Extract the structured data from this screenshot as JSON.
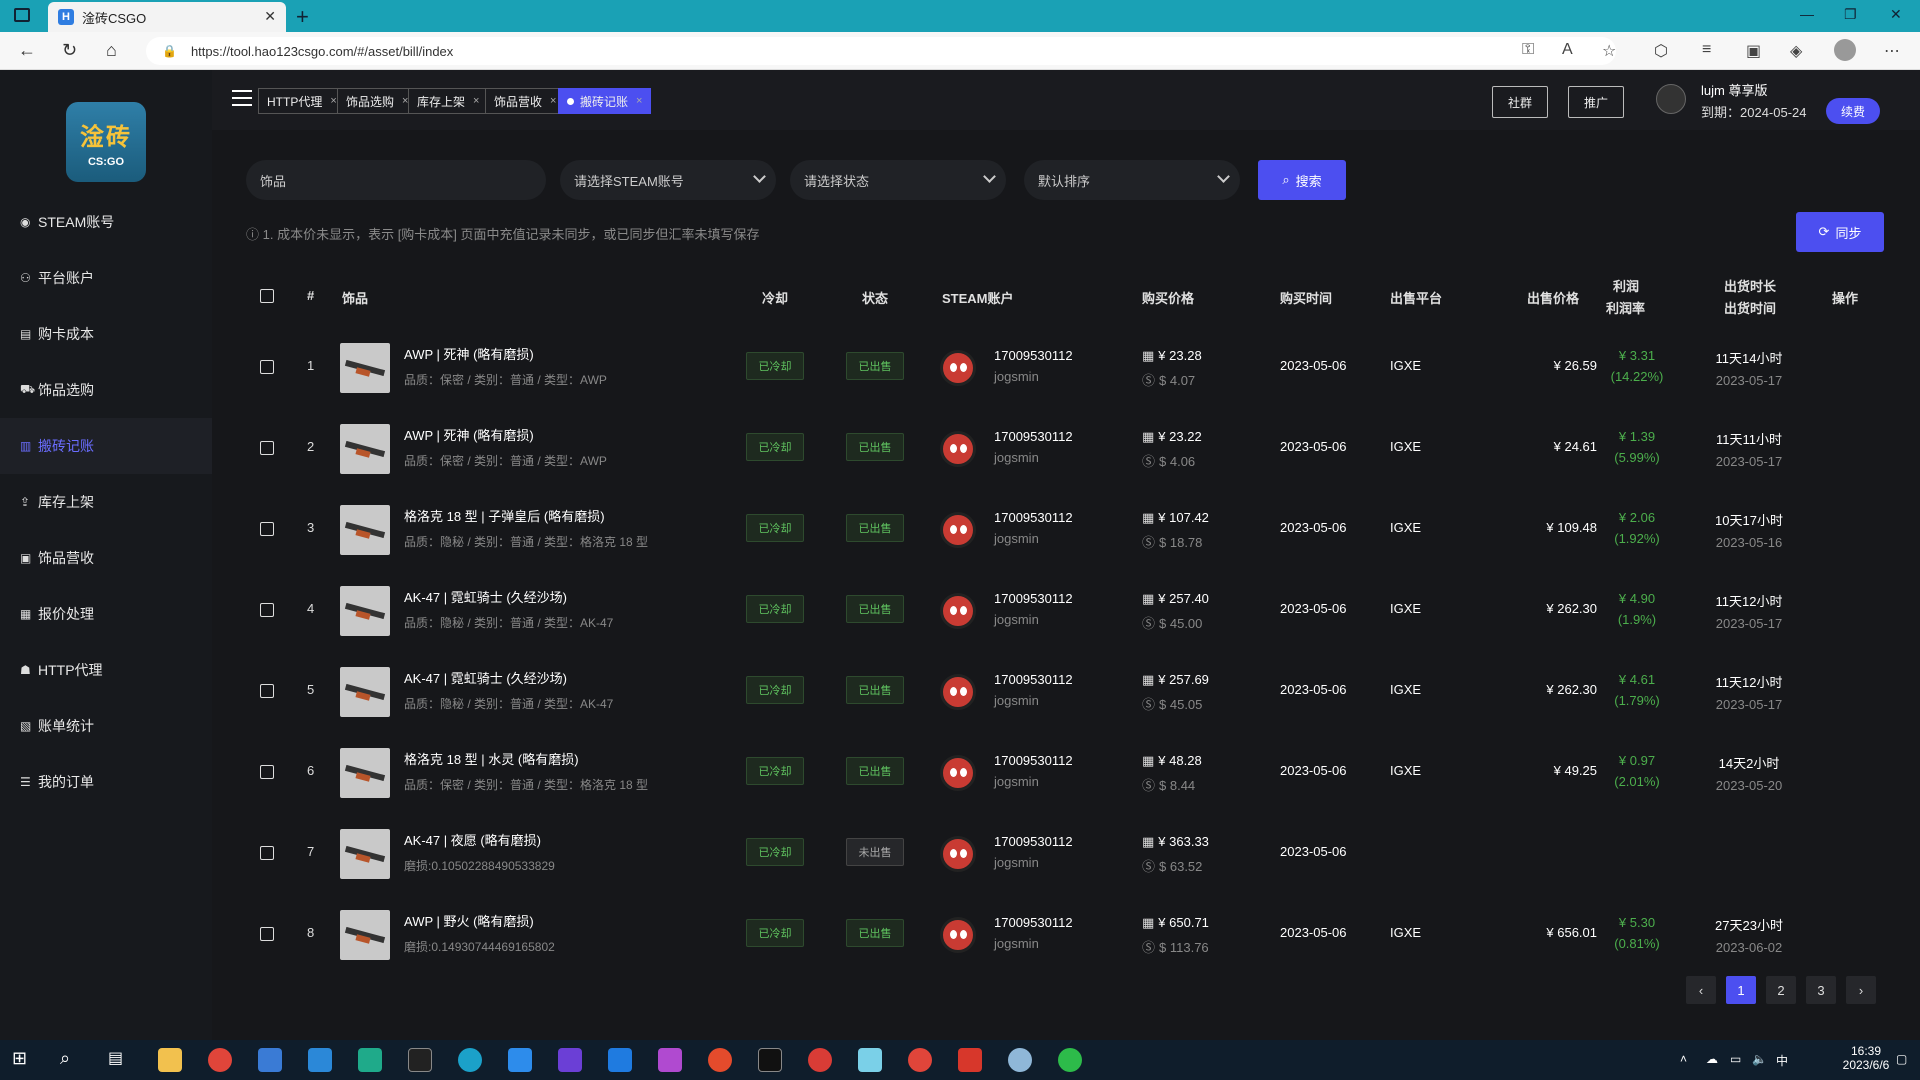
{
  "browser": {
    "tab_title": "淦砖CSGO",
    "tab_favicon": "H",
    "url": "https://tool.hao123csgo.com/#/asset/bill/index"
  },
  "sidebar": {
    "logo_top": "淦砖",
    "logo_bottom": "CS:GO",
    "items": [
      {
        "label": "STEAM账号",
        "icon": "steam-icon"
      },
      {
        "label": "平台账户",
        "icon": "users-icon"
      },
      {
        "label": "购卡成本",
        "icon": "card-icon"
      },
      {
        "label": "饰品选购",
        "icon": "cart-icon"
      },
      {
        "label": "搬砖记账",
        "icon": "book-icon",
        "active": true
      },
      {
        "label": "库存上架",
        "icon": "upload-icon"
      },
      {
        "label": "饰品营收",
        "icon": "wallet-icon"
      },
      {
        "label": "报价处理",
        "icon": "document-icon"
      },
      {
        "label": "HTTP代理",
        "icon": "proxy-icon"
      },
      {
        "label": "账单统计",
        "icon": "chart-icon"
      },
      {
        "label": "我的订单",
        "icon": "order-icon"
      }
    ]
  },
  "topbar": {
    "tabs": [
      {
        "label": "HTTP代理",
        "close": "×"
      },
      {
        "label": "饰品选购",
        "close": "×"
      },
      {
        "label": "库存上架",
        "close": "×"
      },
      {
        "label": "饰品营收",
        "close": "×"
      },
      {
        "label": "搬砖记账",
        "close": "×",
        "active": true
      }
    ],
    "group_btn": "社群",
    "promo_btn": "推广",
    "user_name": "lujm  尊享版",
    "expiry": "到期：2024-05-24",
    "renew_btn": "续费"
  },
  "filters": {
    "item_input": "饰品",
    "steam_select": "请选择STEAM账号",
    "status_select": "请选择状态",
    "sort_select": "默认排序",
    "search_btn": "搜索",
    "sync_btn": "同步",
    "notice": "1. 成本价未显示，表示 [购卡成本] 页面中充值记录未同步，或已同步但汇率未填写保存"
  },
  "table": {
    "headers": {
      "index": "#",
      "item": "饰品",
      "cooldown": "冷却",
      "status": "状态",
      "steam": "STEAM账户",
      "buy_price": "购买价格",
      "buy_time": "购买时间",
      "platform": "出售平台",
      "sell_price": "出售价格",
      "profit": "利润",
      "profit_rate": "利润率",
      "duration": "出货时长",
      "sell_time": "出货时间",
      "action": "操作"
    },
    "rows": [
      {
        "idx": "1",
        "name": "AWP | 死神 (略有磨损)",
        "detail": "品质：保密 / 类别：普通 / 类型：AWP",
        "cooldown": "已冷却",
        "status": "已出售",
        "account": "17009530112",
        "user": "jogsmin",
        "cny": "¥ 23.28",
        "usd": "$ 4.07",
        "date": "2023-05-06",
        "platform": "IGXE",
        "sell": "¥ 26.59",
        "profit": "¥ 3.31",
        "rate": "(14.22%)",
        "duration": "11天14小时",
        "sold": "2023-05-17"
      },
      {
        "idx": "2",
        "name": "AWP | 死神 (略有磨损)",
        "detail": "品质：保密 / 类别：普通 / 类型：AWP",
        "cooldown": "已冷却",
        "status": "已出售",
        "account": "17009530112",
        "user": "jogsmin",
        "cny": "¥ 23.22",
        "usd": "$ 4.06",
        "date": "2023-05-06",
        "platform": "IGXE",
        "sell": "¥ 24.61",
        "profit": "¥ 1.39",
        "rate": "(5.99%)",
        "duration": "11天11小时",
        "sold": "2023-05-17"
      },
      {
        "idx": "3",
        "name": "格洛克 18 型 | 子弹皇后 (略有磨损)",
        "detail": "品质：隐秘 / 类别：普通 / 类型：格洛克 18 型",
        "cooldown": "已冷却",
        "status": "已出售",
        "account": "17009530112",
        "user": "jogsmin",
        "cny": "¥ 107.42",
        "usd": "$ 18.78",
        "date": "2023-05-06",
        "platform": "IGXE",
        "sell": "¥ 109.48",
        "profit": "¥ 2.06",
        "rate": "(1.92%)",
        "duration": "10天17小时",
        "sold": "2023-05-16"
      },
      {
        "idx": "4",
        "name": "AK-47 | 霓虹骑士 (久经沙场)",
        "detail": "品质：隐秘 / 类别：普通 / 类型：AK-47",
        "cooldown": "已冷却",
        "status": "已出售",
        "account": "17009530112",
        "user": "jogsmin",
        "cny": "¥ 257.40",
        "usd": "$ 45.00",
        "date": "2023-05-06",
        "platform": "IGXE",
        "sell": "¥ 262.30",
        "profit": "¥ 4.90",
        "rate": "(1.9%)",
        "duration": "11天12小时",
        "sold": "2023-05-17"
      },
      {
        "idx": "5",
        "name": "AK-47 | 霓虹骑士 (久经沙场)",
        "detail": "品质：隐秘 / 类别：普通 / 类型：AK-47",
        "cooldown": "已冷却",
        "status": "已出售",
        "account": "17009530112",
        "user": "jogsmin",
        "cny": "¥ 257.69",
        "usd": "$ 45.05",
        "date": "2023-05-06",
        "platform": "IGXE",
        "sell": "¥ 262.30",
        "profit": "¥ 4.61",
        "rate": "(1.79%)",
        "duration": "11天12小时",
        "sold": "2023-05-17"
      },
      {
        "idx": "6",
        "name": "格洛克 18 型 | 水灵 (略有磨损)",
        "detail": "品质：保密 / 类别：普通 / 类型：格洛克 18 型",
        "cooldown": "已冷却",
        "status": "已出售",
        "account": "17009530112",
        "user": "jogsmin",
        "cny": "¥ 48.28",
        "usd": "$ 8.44",
        "date": "2023-05-06",
        "platform": "IGXE",
        "sell": "¥ 49.25",
        "profit": "¥ 0.97",
        "rate": "(2.01%)",
        "duration": "14天2小时",
        "sold": "2023-05-20"
      },
      {
        "idx": "7",
        "name": "AK-47 | 夜愿 (略有磨损)",
        "detail": "磨损:0.10502288490533829",
        "cooldown": "已冷却",
        "status": "未出售",
        "account": "17009530112",
        "user": "jogsmin",
        "cny": "¥ 363.33",
        "usd": "$ 63.52",
        "date": "2023-05-06",
        "platform": "",
        "sell": "",
        "profit": "",
        "rate": "",
        "duration": "",
        "sold": ""
      },
      {
        "idx": "8",
        "name": "AWP | 野火 (略有磨损)",
        "detail": "磨损:0.14930744469165802",
        "cooldown": "已冷却",
        "status": "已出售",
        "account": "17009530112",
        "user": "jogsmin",
        "cny": "¥ 650.71",
        "usd": "$ 113.76",
        "date": "2023-05-06",
        "platform": "IGXE",
        "sell": "¥ 656.01",
        "profit": "¥ 5.30",
        "rate": "(0.81%)",
        "duration": "27天23小时",
        "sold": "2023-06-02"
      }
    ]
  },
  "pagination": {
    "prev": "‹",
    "pages": [
      "1",
      "2",
      "3"
    ],
    "current": "1",
    "next": "›"
  },
  "taskbar": {
    "time": "16:39",
    "date": "2023/6/6",
    "ime": "中"
  },
  "colors": {
    "accent": "#4c4ff0",
    "profit": "#4cae4c",
    "tag_green": "#5fc25f",
    "bg": "#16171a"
  }
}
